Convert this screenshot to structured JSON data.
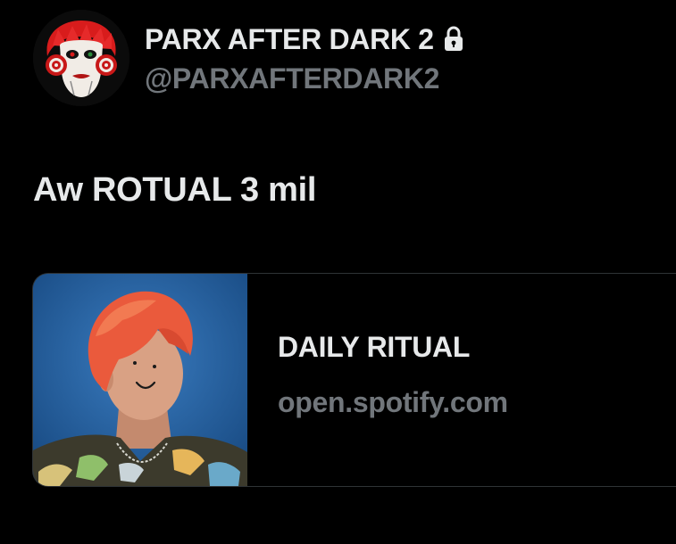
{
  "header": {
    "display_name": "PARX AFTER DARK 2",
    "handle": "@PARXAFTERDARK2",
    "protected_icon": "lock-icon"
  },
  "tweet": {
    "text": "Aw ROTUAL 3 mil"
  },
  "link_card": {
    "title": "DAILY RITUAL",
    "domain": "open.spotify.com",
    "thumbnail": "red-haired-person-photo"
  },
  "colors": {
    "background": "#000000",
    "primary_text": "#e7e9ea",
    "secondary_text": "#71767b",
    "border": "#2f3336"
  }
}
